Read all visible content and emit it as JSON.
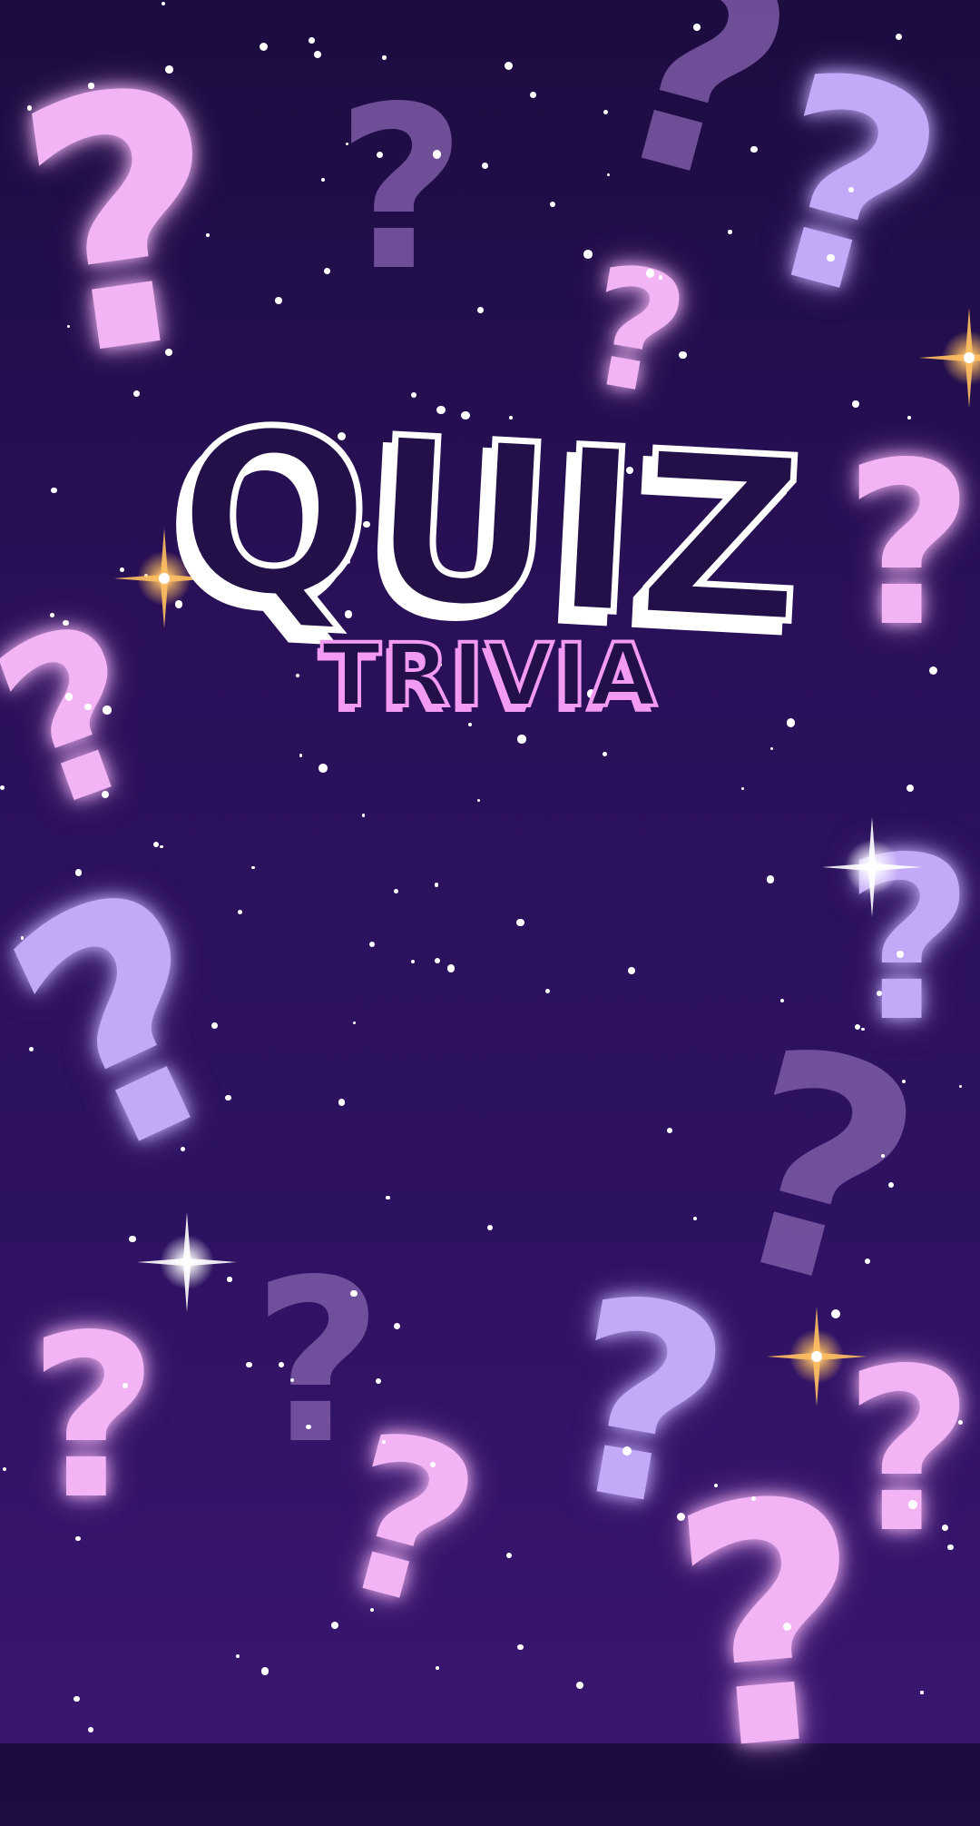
{
  "title": {
    "letters": [
      "Q",
      "U",
      "I",
      "Z"
    ],
    "text": "QUIZ"
  },
  "subtitle": "TRIVIA",
  "decor": {
    "glyph": "?"
  },
  "colors": {
    "pink": "#f2b4f4",
    "lavender": "#c3aaf8",
    "dim": "#7c5aa6",
    "title_fill": "#241048",
    "title_outline": "#ffffff",
    "subtitle_outline": "#f39af3",
    "gold_sparkle": "#ffc060",
    "white_sparkle": "#ffffff"
  }
}
